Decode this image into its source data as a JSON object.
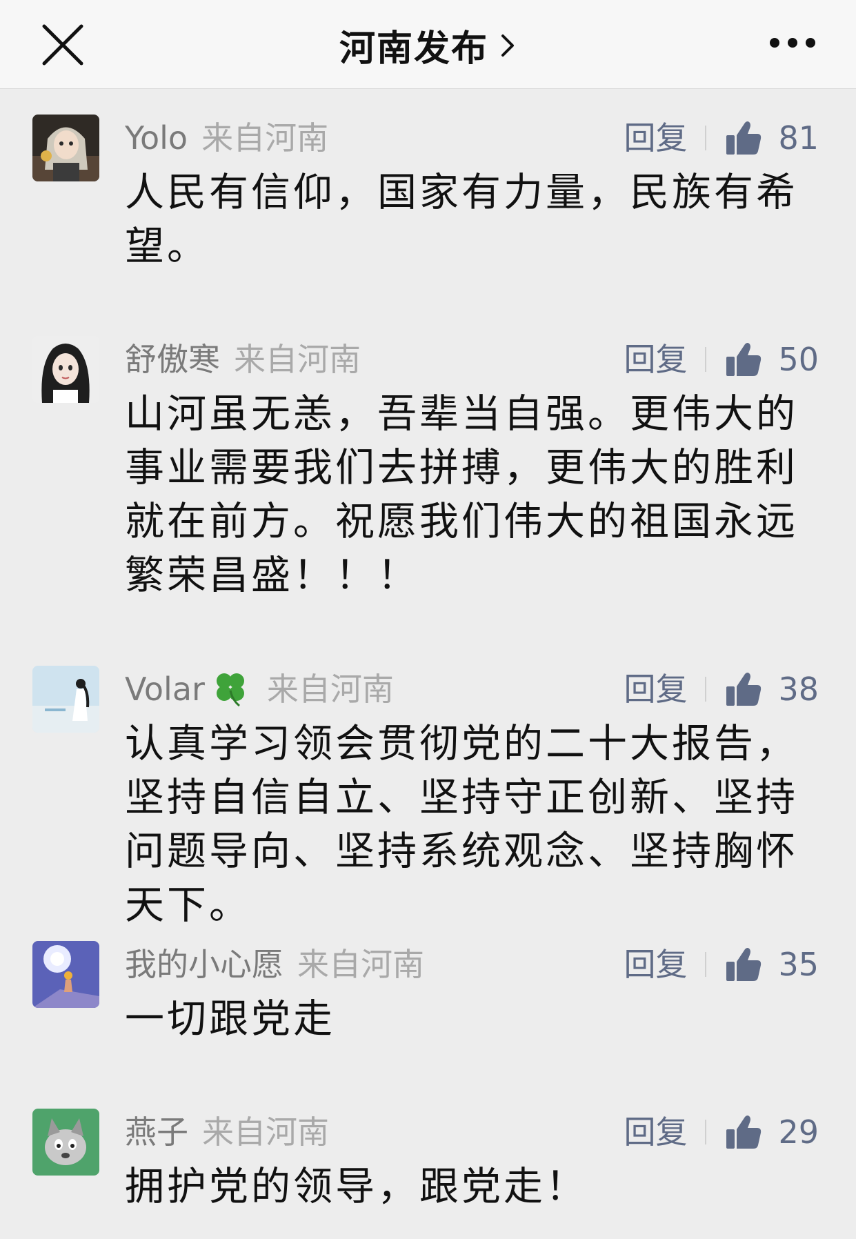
{
  "header": {
    "title": "河南发布",
    "close_icon": "close-icon",
    "more_icon": "more-dots-icon"
  },
  "colors": {
    "accent": "#5f6b86",
    "nickname": "#7a7a7a",
    "location": "#a9a9a9",
    "background": "#ededed"
  },
  "comments": [
    {
      "nickname": "Yolo",
      "location": "来自河南",
      "reply": "回复",
      "likes": "81",
      "content": "人民有信仰，国家有力量，民族有希望。"
    },
    {
      "nickname": "舒傲寒",
      "location": "来自河南",
      "reply": "回复",
      "likes": "50",
      "content": "山河虽无恙，吾辈当自强。更伟大的事业需要我们去拼搏，更伟大的胜利就在前方。祝愿我们伟大的祖国永远繁荣昌盛！！！"
    },
    {
      "nickname": "Volar",
      "location": "来自河南",
      "reply": "回复",
      "likes": "38",
      "content": "认真学习领会贯彻党的二十大报告，坚持自信自立、坚持守正创新、坚持问题导向、坚持系统观念、坚持胸怀天下。"
    },
    {
      "nickname": "我的小心愿",
      "location": "来自河南",
      "reply": "回复",
      "likes": "35",
      "content": "一切跟党走"
    },
    {
      "nickname": "燕子",
      "location": "来自河南",
      "reply": "回复",
      "likes": "29",
      "content": "拥护党的领导，跟党走！"
    }
  ]
}
